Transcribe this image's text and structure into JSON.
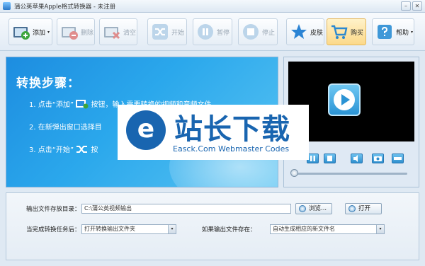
{
  "window": {
    "title": "蒲公英苹果Apple格式转换器 - 未注册",
    "minimize_glyph": "–",
    "close_glyph": "✕"
  },
  "toolbar": {
    "buttons": [
      {
        "label": "添加",
        "icon": "add-video-icon",
        "enabled": true,
        "dropdown": true
      },
      {
        "label": "删除",
        "icon": "remove-video-icon",
        "enabled": false,
        "dropdown": false
      },
      {
        "label": "清空",
        "icon": "clear-video-icon",
        "enabled": false,
        "dropdown": false
      },
      {
        "label": "开始",
        "icon": "shuffle-icon",
        "enabled": false,
        "dropdown": false
      },
      {
        "label": "暂停",
        "icon": "pause-icon",
        "enabled": false,
        "dropdown": false
      },
      {
        "label": "停止",
        "icon": "stop-icon",
        "enabled": false,
        "dropdown": false
      },
      {
        "label": "皮肤",
        "icon": "star-icon",
        "enabled": true,
        "dropdown": false
      },
      {
        "label": "购买",
        "icon": "cart-icon",
        "enabled": true,
        "dropdown": false
      },
      {
        "label": "帮助",
        "icon": "help-icon",
        "enabled": true,
        "dropdown": true
      }
    ],
    "dropdown_glyph": "▾"
  },
  "steps": {
    "title": "转换步骤：",
    "items": [
      {
        "before": "1. 点击“添加”",
        "after": "按钮，输入需要转换的视频和音频文件。"
      },
      {
        "before": "2. 在新弹出窗口选择目",
        "after": ""
      },
      {
        "before": "3. 点击“开始”",
        "after": "按"
      }
    ]
  },
  "watermark": {
    "logo_letter": "e",
    "main_text": "站长下载",
    "sub_text": "Easck.Com Webmaster Codes"
  },
  "player": {
    "controls": [
      "pause-icon",
      "stop-icon",
      "volume-icon",
      "snapshot-icon",
      "fullscreen-icon"
    ],
    "progress": 0
  },
  "settings": {
    "output_dir_label": "输出文件存放目录：",
    "output_dir_value": "C:\\蒲公英视频输出",
    "browse_label": "浏览...",
    "open_label": "打开",
    "after_convert_label": "当完成转换任务后：",
    "after_convert_value": "打开转换输出文件夹",
    "if_exists_label": "如果输出文件存在：",
    "if_exists_value": "自动生成相应的新文件名",
    "select_arrow": "▾"
  },
  "colors": {
    "accent": "#1f8fdf",
    "watermark_blue": "#1965b0",
    "buy_highlight": "#fcd98a"
  }
}
